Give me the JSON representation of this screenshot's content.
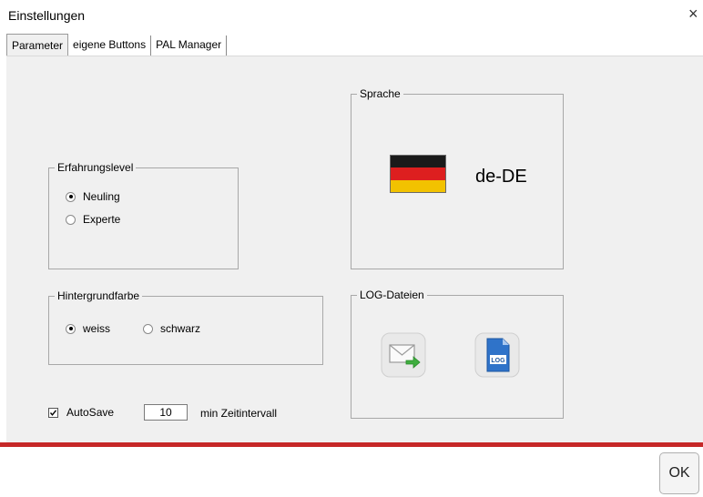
{
  "window": {
    "title": "Einstellungen",
    "close_glyph": "×"
  },
  "tabs": [
    {
      "label": "Parameter",
      "active": true
    },
    {
      "label": "eigene Buttons",
      "active": false
    },
    {
      "label": "PAL Manager",
      "active": false
    }
  ],
  "erfahrung": {
    "legend": "Erfahrungslevel",
    "options": [
      {
        "label": "Neuling",
        "selected": true
      },
      {
        "label": "Experte",
        "selected": false
      }
    ]
  },
  "hintergrund": {
    "legend": "Hintergrundfarbe",
    "options": [
      {
        "label": "weiss",
        "selected": true
      },
      {
        "label": "schwarz",
        "selected": false
      }
    ]
  },
  "autosave": {
    "label": "AutoSave",
    "checked": true,
    "value": "10",
    "unit": "min Zeitintervall"
  },
  "sprache": {
    "legend": "Sprache",
    "code": "de-DE",
    "flag": "german-flag",
    "flag_colors": [
      "#1a1a1a",
      "#dd1f1f",
      "#f2c200"
    ]
  },
  "log": {
    "legend": "LOG-Dateien",
    "icons": [
      "email-send-icon",
      "log-file-icon"
    ]
  },
  "colors": {
    "accent_line": "#c62828",
    "panel_bg": "#f0f0f0"
  },
  "footer": {
    "ok_label": "OK"
  }
}
